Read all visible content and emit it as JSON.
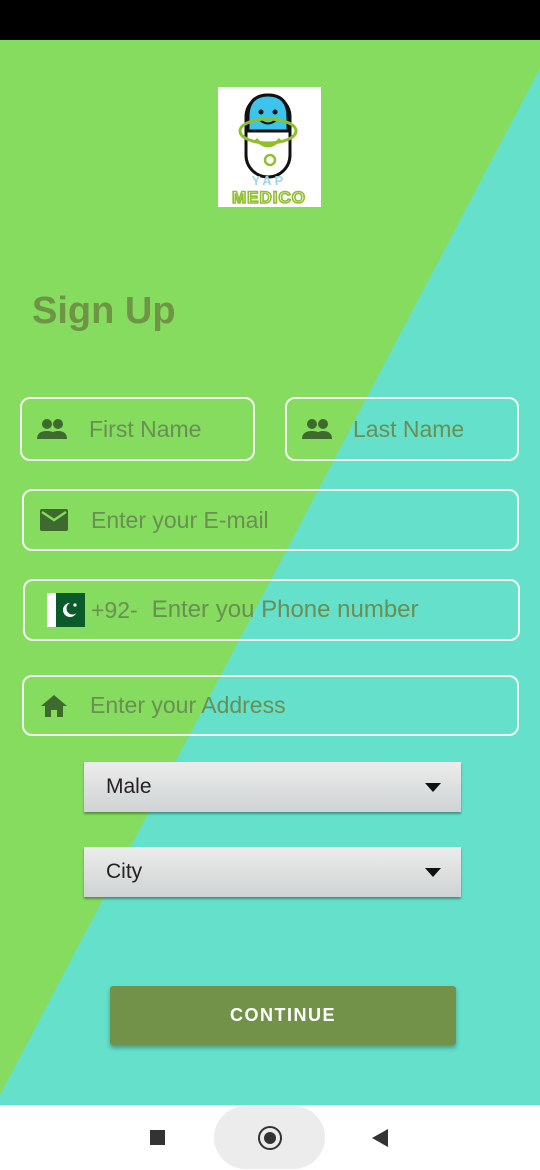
{
  "logo": {
    "brand_text": "YAP MEDICO"
  },
  "title": "Sign Up",
  "first_name": {
    "placeholder": "First Name",
    "icon": "people-icon"
  },
  "last_name": {
    "placeholder": "Last Name",
    "icon": "people-icon"
  },
  "email": {
    "placeholder": "Enter your E-mail",
    "icon": "mail-icon"
  },
  "phone": {
    "country_code": "+92-",
    "placeholder": "Enter you Phone number",
    "icon": "pakistan-flag-icon"
  },
  "address": {
    "placeholder": "Enter your Address",
    "icon": "home-icon"
  },
  "gender_select": {
    "value": "Male"
  },
  "city_select": {
    "value": "City"
  },
  "continue_label": "CONTINUE",
  "colors": {
    "green": "#85dc5f",
    "teal": "#64e0cb",
    "accent": "#72924a",
    "title": "#6f9445"
  },
  "nav": {
    "recent": "recent-apps-icon",
    "home": "home-circle-icon",
    "back": "back-icon"
  }
}
